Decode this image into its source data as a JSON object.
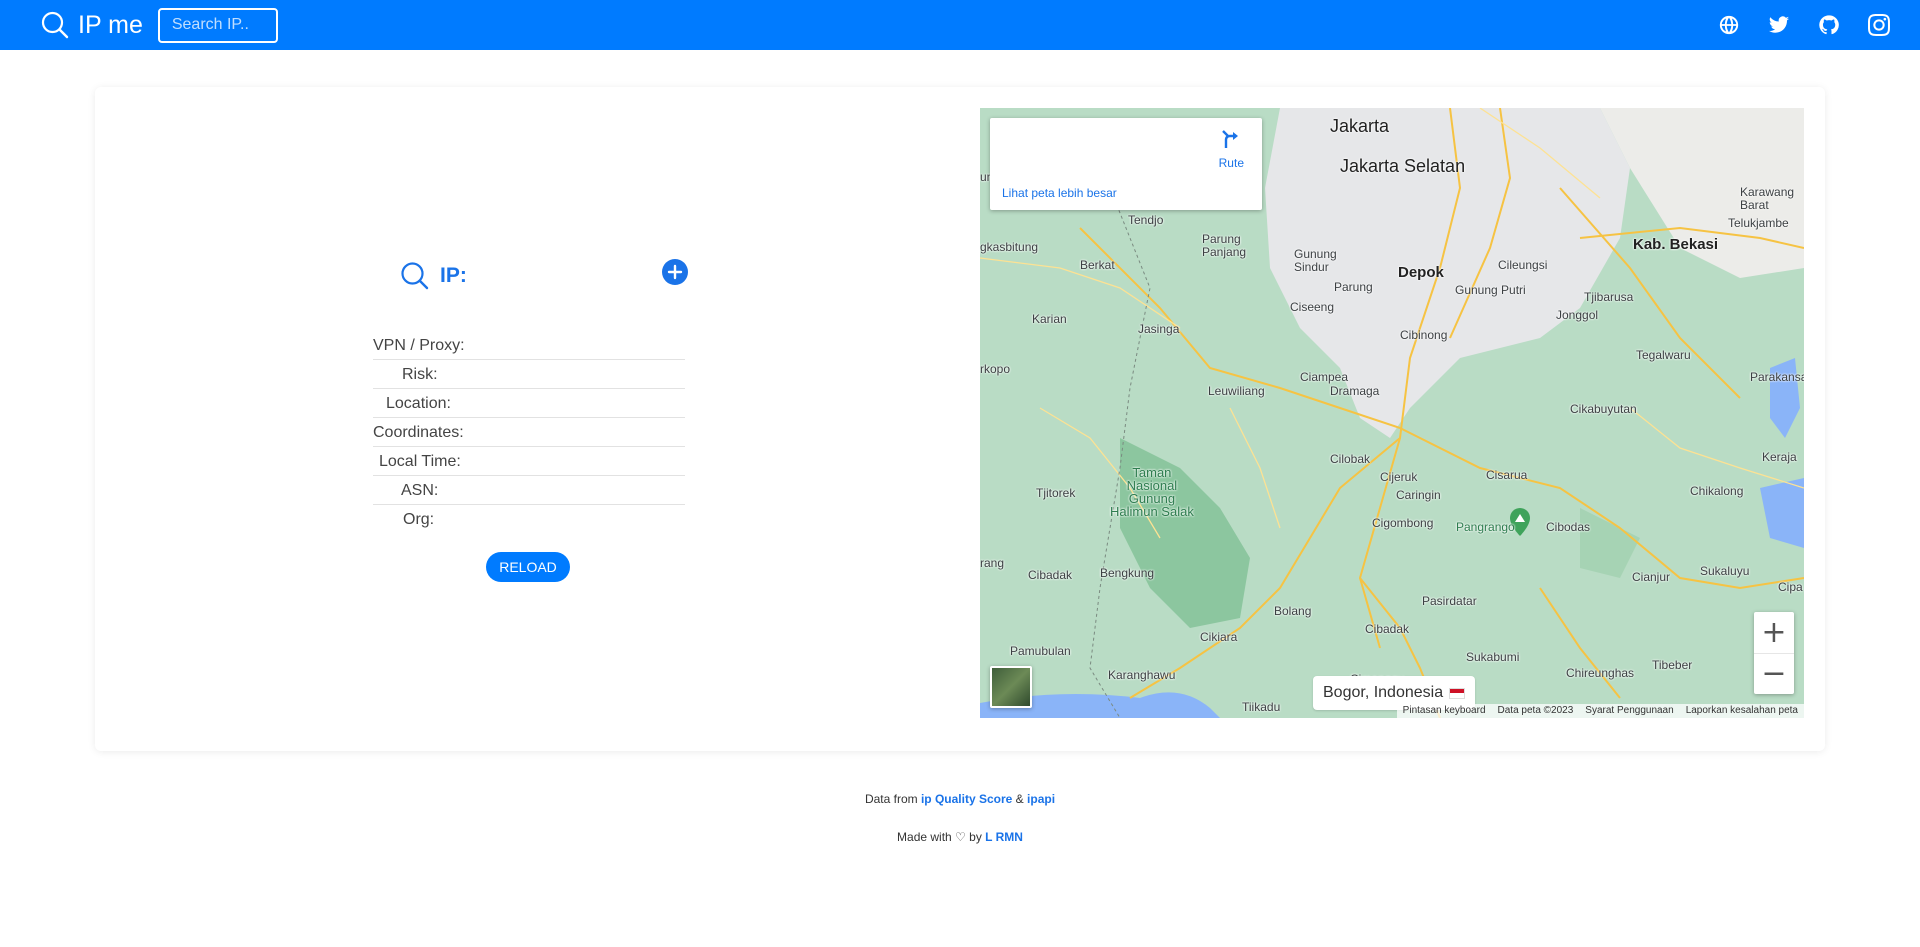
{
  "navbar": {
    "brand": "IP me",
    "search_placeholder": "Search IP..",
    "icons": [
      "globe-icon",
      "twitter-icon",
      "github-icon",
      "instagram-icon"
    ],
    "bg_color": "#007bff"
  },
  "ip_panel": {
    "title": "IP:",
    "rows": [
      {
        "label": "VPN / Proxy:",
        "value": ""
      },
      {
        "label": "Risk:",
        "value": ""
      },
      {
        "label": "Location:",
        "value": ""
      },
      {
        "label": "Coordinates:",
        "value": ""
      },
      {
        "label": "Local Time:",
        "value": ""
      },
      {
        "label": "ASN:",
        "value": ""
      },
      {
        "label": "Org:",
        "value": ""
      }
    ],
    "reload_label": "RELOAD"
  },
  "map": {
    "route_label": "Rute",
    "bigger_map_link": "Lihat peta lebih besar",
    "zoom_in": "+",
    "zoom_out": "−",
    "location": "Bogor, Indonesia",
    "attribution": {
      "keyboard": "Pintasan keyboard",
      "data": "Data peta ©2023",
      "terms": "Syarat Penggunaan",
      "report": "Laporkan kesalahan peta"
    },
    "places": {
      "jakarta": "Jakarta",
      "jakarta_selatan": "Jakarta Selatan",
      "depok": "Depok",
      "kab_bekasi": "Kab. Bekasi",
      "tendjo": "Tendjo",
      "parung_panjang": "Parung\nPanjang",
      "gunung_sindur": "Gunung\nSindur",
      "cileungsi": "Cileungsi",
      "gunung_putri": "Gunung Putri",
      "parung": "Parung",
      "berkat": "Berkat",
      "ciseeng": "Ciseeng",
      "tjibarusa": "Tjibarusa",
      "jonggol": "Jonggol",
      "karian": "Karian",
      "jasinga": "Jasinga",
      "cibinong": "Cibinong",
      "tegalwaru": "Tegalwaru",
      "parakansa": "Parakansa",
      "ciampea": "Ciampea",
      "leuwiliang": "Leuwiliang",
      "dramaga": "Dramaga",
      "cikabuyutan": "Cikabuyutan",
      "keraja": "Keraja",
      "cilobak": "Cilobak",
      "cijeruk": "Cijeruk",
      "cisarua": "Cisarua",
      "caringin": "Caringin",
      "tjitorek": "Tjitorek",
      "park": "Taman\nNasional\nGunung\nHalimun Salak",
      "chikalong": "Chikalong",
      "cigombong": "Cigombong",
      "pangrango": "Pangrango",
      "cibodas": "Cibodas",
      "cibadak1": "Cibadak",
      "bengkung": "Bengkung",
      "cianjur": "Cianjur",
      "sukaluyu": "Sukaluyu",
      "cipa": "Cipa",
      "pasirdatar": "Pasirdatar",
      "bolang": "Bolang",
      "cibadak2": "Cibadak",
      "pamubulan": "Pamubulan",
      "cikiara": "Cikiara",
      "sukabumi": "Sukabumi",
      "chireunghas": "Chireunghas",
      "tibeber": "Tibeber",
      "karanghawu": "Karanghawu",
      "cimanggu": "Cimanggu",
      "tiikadu": "Tiikadu",
      "karawang_barat": "Karawang\nBarat",
      "telukjambe": "Telukjambe",
      "gkasbitung": "gkasbitung",
      "rkopo": "rkopo",
      "rang": "rang",
      "ung": "ung"
    }
  },
  "footer": {
    "data_from": "Data from",
    "source1": "ip Quality Score",
    "amp": "&",
    "source2": "ipapi",
    "made_with": "Made with ♡ by",
    "author": "L RMN"
  }
}
